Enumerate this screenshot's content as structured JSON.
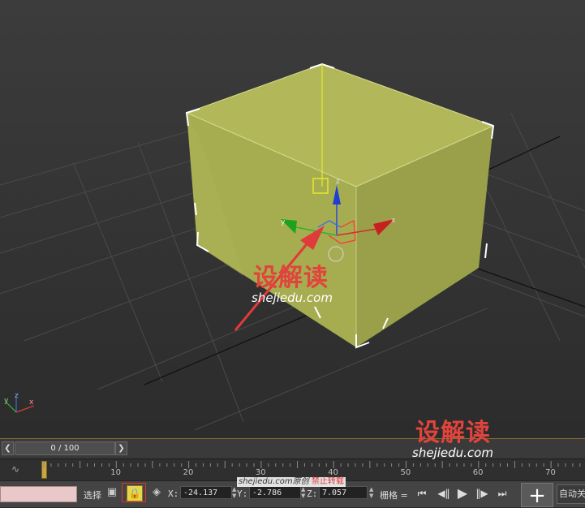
{
  "viewport": {
    "gizmo_labels": {
      "x": "x",
      "y": "y",
      "z": "z"
    },
    "corner_axes": {
      "x": "x",
      "y": "y",
      "z": "z"
    },
    "colors": {
      "box_front": "#a6ac50",
      "box_top": "#b2b85a",
      "box_right": "#9aa04a",
      "selection": "#ffffff",
      "annotation_arrow": "#e03a3a"
    },
    "watermark_center": {
      "cn": "设解读",
      "en": "shejiedu.com"
    },
    "watermark_right": {
      "cn": "设解读",
      "en": "shejiedu.com"
    }
  },
  "timeslider": {
    "prev_icon": "chevron-left-icon",
    "next_icon": "chevron-right-icon",
    "frame_display": "0 / 100"
  },
  "timeline": {
    "icon": "curve-editor-icon",
    "ticks": [
      "10",
      "20",
      "30",
      "40",
      "50",
      "60",
      "70"
    ],
    "current_frame": 0
  },
  "statusbar": {
    "select_label": "选择",
    "coords": {
      "x_label": "X:",
      "x_value": "-24.137",
      "y_label": "Y:",
      "y_value": "-2.786",
      "z_label": "Z:",
      "z_value": "7.057"
    },
    "grid_label": "栅格 =",
    "auto_key_label": "自动关键点",
    "overlay_text": {
      "site": "shejiedu.com原创",
      "notice": "禁止转载"
    }
  }
}
